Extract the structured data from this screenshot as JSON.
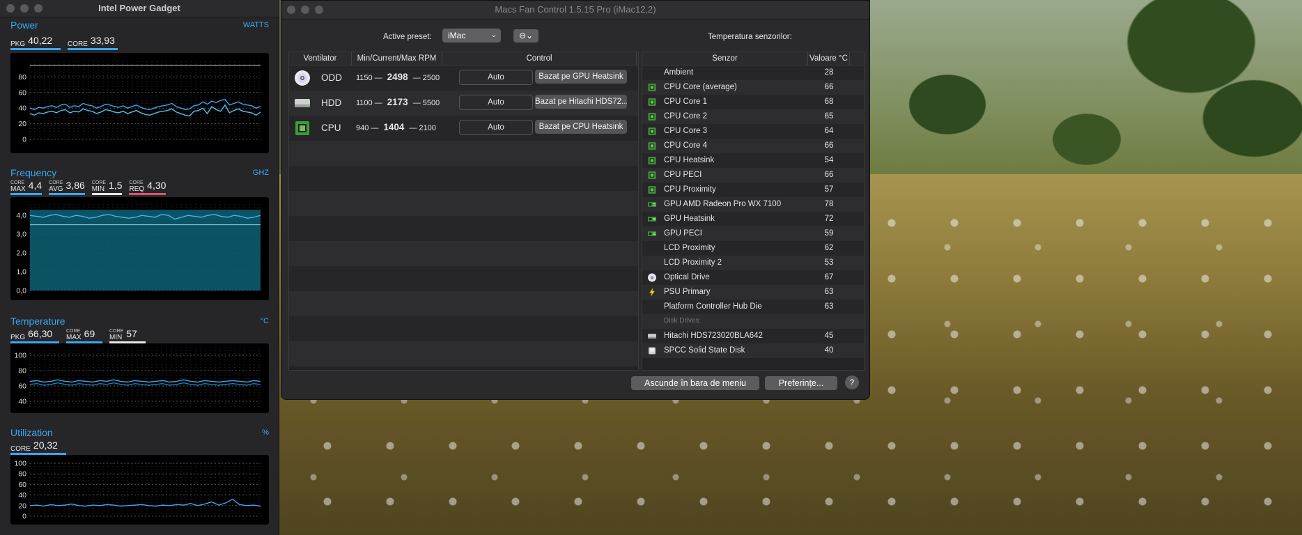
{
  "ipg": {
    "title": "Intel Power Gadget",
    "power": {
      "name": "Power",
      "unit": "WATTS",
      "pkg_label": "PKG",
      "pkg_value": "40,22",
      "core_label": "CORE",
      "core_value": "33,93",
      "y_ticks": [
        "80",
        "60",
        "40",
        "20",
        "0"
      ],
      "pkg_series": [
        40,
        38,
        41,
        40,
        42,
        43,
        41,
        44,
        45,
        41,
        43,
        42,
        46,
        44,
        43,
        40,
        42,
        45,
        44,
        42,
        41,
        43,
        40,
        42,
        44,
        41,
        39,
        38,
        40,
        42,
        43,
        44,
        46,
        42,
        40,
        38,
        39,
        43,
        44,
        48,
        45,
        49,
        47,
        50,
        51,
        44,
        46,
        48,
        45,
        44,
        43,
        40,
        42
      ],
      "core_series": [
        33,
        31,
        34,
        33,
        35,
        36,
        34,
        37,
        38,
        34,
        36,
        35,
        39,
        37,
        36,
        33,
        35,
        38,
        37,
        35,
        34,
        36,
        33,
        35,
        37,
        34,
        32,
        31,
        33,
        35,
        36,
        37,
        39,
        35,
        33,
        31,
        30,
        36,
        37,
        40,
        33,
        42,
        38,
        36,
        44,
        34,
        37,
        39,
        36,
        35,
        34,
        31,
        35
      ]
    },
    "frequency": {
      "name": "Frequency",
      "unit": "GHZ",
      "max_top": "CORE",
      "max_bottom": "MAX",
      "max_value": "4,4",
      "avg_top": "CORE",
      "avg_bottom": "AVG",
      "avg_value": "3,86",
      "min_top": "CORE",
      "min_bottom": "MIN",
      "min_value": "1,5",
      "req_top": "CORE",
      "req_bottom": "REQ",
      "req_value": "4,30",
      "y_ticks": [
        "4,0",
        "3,0",
        "2,0",
        "1,0",
        "0,0"
      ],
      "series": [
        4.0,
        3.95,
        3.9,
        4.0,
        4.05,
        3.95,
        3.9,
        4.0,
        3.95,
        3.85,
        3.9,
        4.0,
        4.05,
        3.95,
        3.9,
        3.85,
        3.9,
        4.0,
        3.95,
        3.9,
        4.05,
        4.0,
        3.8,
        3.9,
        4.0,
        3.95,
        3.9,
        4.0,
        4.05,
        3.95,
        3.9,
        4.0,
        3.95,
        3.85,
        3.9,
        4.0
      ]
    },
    "temperature": {
      "name": "Temperature",
      "unit": "°C",
      "pkg_label": "PKG",
      "pkg_value": "66,30",
      "max_top": "CORE",
      "max_bottom": "MAX",
      "max_value": "69",
      "min_top": "CORE",
      "min_bottom": "MIN",
      "min_value": "57",
      "y_ticks": [
        "100",
        "80",
        "60",
        "40"
      ],
      "series_a": [
        66,
        67,
        65,
        66,
        68,
        66,
        65,
        67,
        66,
        65,
        67,
        66,
        68,
        66,
        65,
        67,
        66,
        65,
        66,
        67,
        65,
        66,
        68,
        66,
        65,
        67,
        66,
        65,
        66,
        67,
        66,
        65,
        67,
        66
      ],
      "series_b": [
        62,
        63,
        61,
        62,
        64,
        62,
        61,
        63,
        62,
        61,
        63,
        62,
        64,
        62,
        61,
        63,
        62,
        61,
        62,
        63,
        61,
        62,
        64,
        62,
        61,
        63,
        62,
        61,
        62,
        63,
        62,
        61,
        63,
        62
      ]
    },
    "utilization": {
      "name": "Utilization",
      "unit": "%",
      "core_label": "CORE",
      "core_value": "20,32",
      "y_ticks": [
        "100",
        "80",
        "60",
        "40",
        "20",
        "0"
      ],
      "series": [
        20,
        21,
        19,
        22,
        20,
        21,
        23,
        20,
        19,
        21,
        20,
        22,
        21,
        19,
        20,
        21,
        22,
        20,
        19,
        21,
        20,
        22,
        21,
        24,
        20,
        23,
        27,
        21,
        25,
        32,
        22,
        20,
        21,
        19
      ]
    }
  },
  "mfc": {
    "title": "Macs Fan Control 1.5.15 Pro (iMac12,2)",
    "preset_label": "Active preset:",
    "preset_value": "iMac",
    "more_label": "⊖⌄",
    "sensors_title": "Temperatura senzorilor:",
    "fan_headers": [
      "Ventilator",
      "Min/Current/Max RPM",
      "Control"
    ],
    "fans": [
      {
        "name": "ODD",
        "min": "1150",
        "current": "2498",
        "max": "2500",
        "auto": "Auto",
        "mode": "Bazat pe GPU Heatsink",
        "icon": "optical-disc-icon"
      },
      {
        "name": "HDD",
        "min": "1100",
        "current": "2173",
        "max": "5500",
        "auto": "Auto",
        "mode": "Bazat pe Hitachi HDS72...",
        "icon": "hard-drive-icon"
      },
      {
        "name": "CPU",
        "min": "940",
        "current": "1404",
        "max": "2100",
        "auto": "Auto",
        "mode": "Bazat pe CPU Heatsink",
        "icon": "cpu-chip-icon"
      }
    ],
    "sensor_headers": [
      "Senzor",
      "Valoare °C"
    ],
    "sensors": [
      {
        "name": "Ambient",
        "value": "28",
        "icon": "none"
      },
      {
        "name": "CPU Core (average)",
        "value": "66",
        "icon": "cpu"
      },
      {
        "name": "CPU Core 1",
        "value": "68",
        "icon": "cpu"
      },
      {
        "name": "CPU Core 2",
        "value": "65",
        "icon": "cpu"
      },
      {
        "name": "CPU Core 3",
        "value": "64",
        "icon": "cpu"
      },
      {
        "name": "CPU Core 4",
        "value": "66",
        "icon": "cpu"
      },
      {
        "name": "CPU Heatsink",
        "value": "54",
        "icon": "cpu"
      },
      {
        "name": "CPU PECI",
        "value": "66",
        "icon": "cpu"
      },
      {
        "name": "CPU Proximity",
        "value": "57",
        "icon": "cpu"
      },
      {
        "name": "GPU AMD Radeon Pro WX 7100",
        "value": "78",
        "icon": "gpu"
      },
      {
        "name": "GPU Heatsink",
        "value": "72",
        "icon": "gpu"
      },
      {
        "name": "GPU PECI",
        "value": "59",
        "icon": "gpu"
      },
      {
        "name": "LCD Proximity",
        "value": "62",
        "icon": "none"
      },
      {
        "name": "LCD Proximity 2",
        "value": "53",
        "icon": "none"
      },
      {
        "name": "Optical Drive",
        "value": "67",
        "icon": "disc"
      },
      {
        "name": "PSU Primary",
        "value": "63",
        "icon": "bolt"
      },
      {
        "name": "Platform Controller Hub Die",
        "value": "63",
        "icon": "none"
      },
      {
        "name": "Disk Drives:",
        "value": "",
        "icon": "section"
      },
      {
        "name": "Hitachi HDS723020BLA642",
        "value": "45",
        "icon": "hdd"
      },
      {
        "name": "SPCC Solid State Disk",
        "value": "40",
        "icon": "ssd"
      }
    ],
    "hide_menu_label": "Ascunde în bara de meniu",
    "prefs_label": "Preferințe...",
    "help_label": "?"
  },
  "colors": {
    "accent": "#3ba7f0",
    "req_bar": "#e0506a",
    "chip_green": "#3f9a3a"
  }
}
